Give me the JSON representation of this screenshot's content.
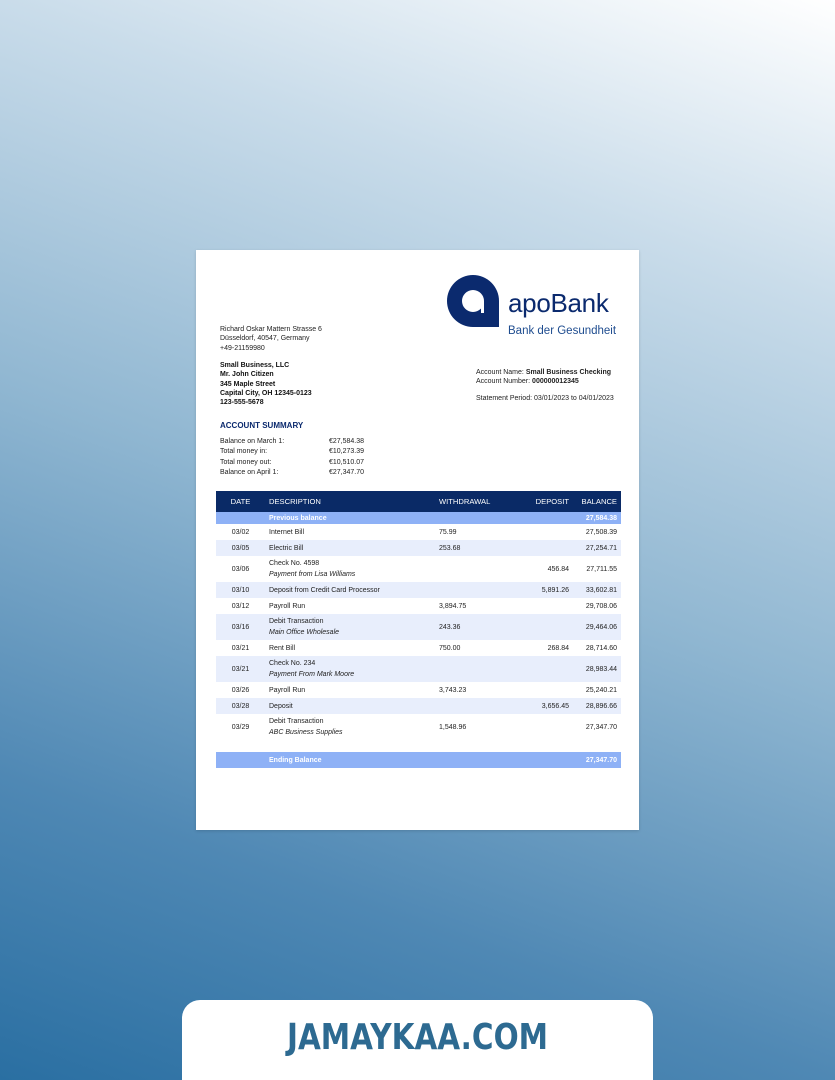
{
  "bank": {
    "name": "apoBank",
    "tagline": "Bank der Gesundheit",
    "brand_color": "#0b2a6e",
    "logo_icon": "apobank-a-logo-icon"
  },
  "bank_address": [
    "Richard Oskar Mattern Strasse 6",
    "Düsseldorf, 40547, Germany",
    "+49-21159980"
  ],
  "customer": [
    "Small Business, LLC",
    "Mr. John Citizen",
    "345 Maple Street",
    "Capital City, OH 12345-0123",
    "123-555-5678"
  ],
  "account": {
    "name_label": "Account Name:",
    "name_value": "Small Business Checking",
    "number_label": "Account Number:",
    "number_value": "000000012345",
    "period": "Statement Period: 03/01/2023 to 04/01/2023"
  },
  "summary": {
    "title": "ACCOUNT SUMMARY",
    "rows": [
      {
        "label": "Balance on March 1:",
        "value": "€27,584.38"
      },
      {
        "label": "Total money in:",
        "value": "€10,273.39"
      },
      {
        "label": "Total money out:",
        "value": "€10,510.07"
      },
      {
        "label": "Balance on April 1:",
        "value": "€27,347.70"
      }
    ]
  },
  "table": {
    "headers": {
      "date": "DATE",
      "description": "DESCRIPTION",
      "withdrawal": "WITHDRAWAL",
      "deposit": "DEPOSIT",
      "balance": "BALANCE"
    },
    "previous": {
      "label": "Previous balance",
      "balance": "27,584.38"
    },
    "rows": [
      {
        "date": "03/02",
        "desc": "Internet Bill",
        "sub": "",
        "wd": "75.99",
        "dep": "",
        "bal": "27,508.39"
      },
      {
        "date": "03/05",
        "desc": "Electric Bill",
        "sub": "",
        "wd": "253.68",
        "dep": "",
        "bal": "27,254.71"
      },
      {
        "date": "03/06",
        "desc": "Check No. 4598",
        "sub": "Payment from Lisa Williams",
        "wd": "",
        "dep": "456.84",
        "bal": "27,711.55"
      },
      {
        "date": "03/10",
        "desc": "Deposit from Credit Card Processor",
        "sub": "",
        "wd": "",
        "dep": "5,891.26",
        "bal": "33,602.81"
      },
      {
        "date": "03/12",
        "desc": "Payroll Run",
        "sub": "",
        "wd": "3,894.75",
        "dep": "",
        "bal": "29,708.06"
      },
      {
        "date": "03/16",
        "desc": "Debit Transaction",
        "sub": "Main Office Wholesale",
        "wd": "243.36",
        "dep": "",
        "bal": "29,464.06"
      },
      {
        "date": "03/21",
        "desc": "Rent Bill",
        "sub": "",
        "wd": "750.00",
        "dep": "268.84",
        "bal": "28,714.60"
      },
      {
        "date": "03/21",
        "desc": "Check No. 234",
        "sub": "Payment From Mark Moore",
        "wd": "",
        "dep": "",
        "bal": "28,983.44"
      },
      {
        "date": "03/26",
        "desc": "Payroll Run",
        "sub": "",
        "wd": "3,743.23",
        "dep": "",
        "bal": "25,240.21"
      },
      {
        "date": "03/28",
        "desc": "Deposit",
        "sub": "",
        "wd": "",
        "dep": "3,656.45",
        "bal": "28,896.66"
      },
      {
        "date": "03/29",
        "desc": "Debit Transaction",
        "sub": "ABC Business Supplies",
        "wd": "1,548.96",
        "dep": "",
        "bal": "27,347.70"
      }
    ],
    "ending": {
      "label": "Ending Balance",
      "balance": "27,347.70"
    }
  },
  "footer": {
    "site": "JAMAYKAA.COM",
    "color": "#2d6a91"
  }
}
